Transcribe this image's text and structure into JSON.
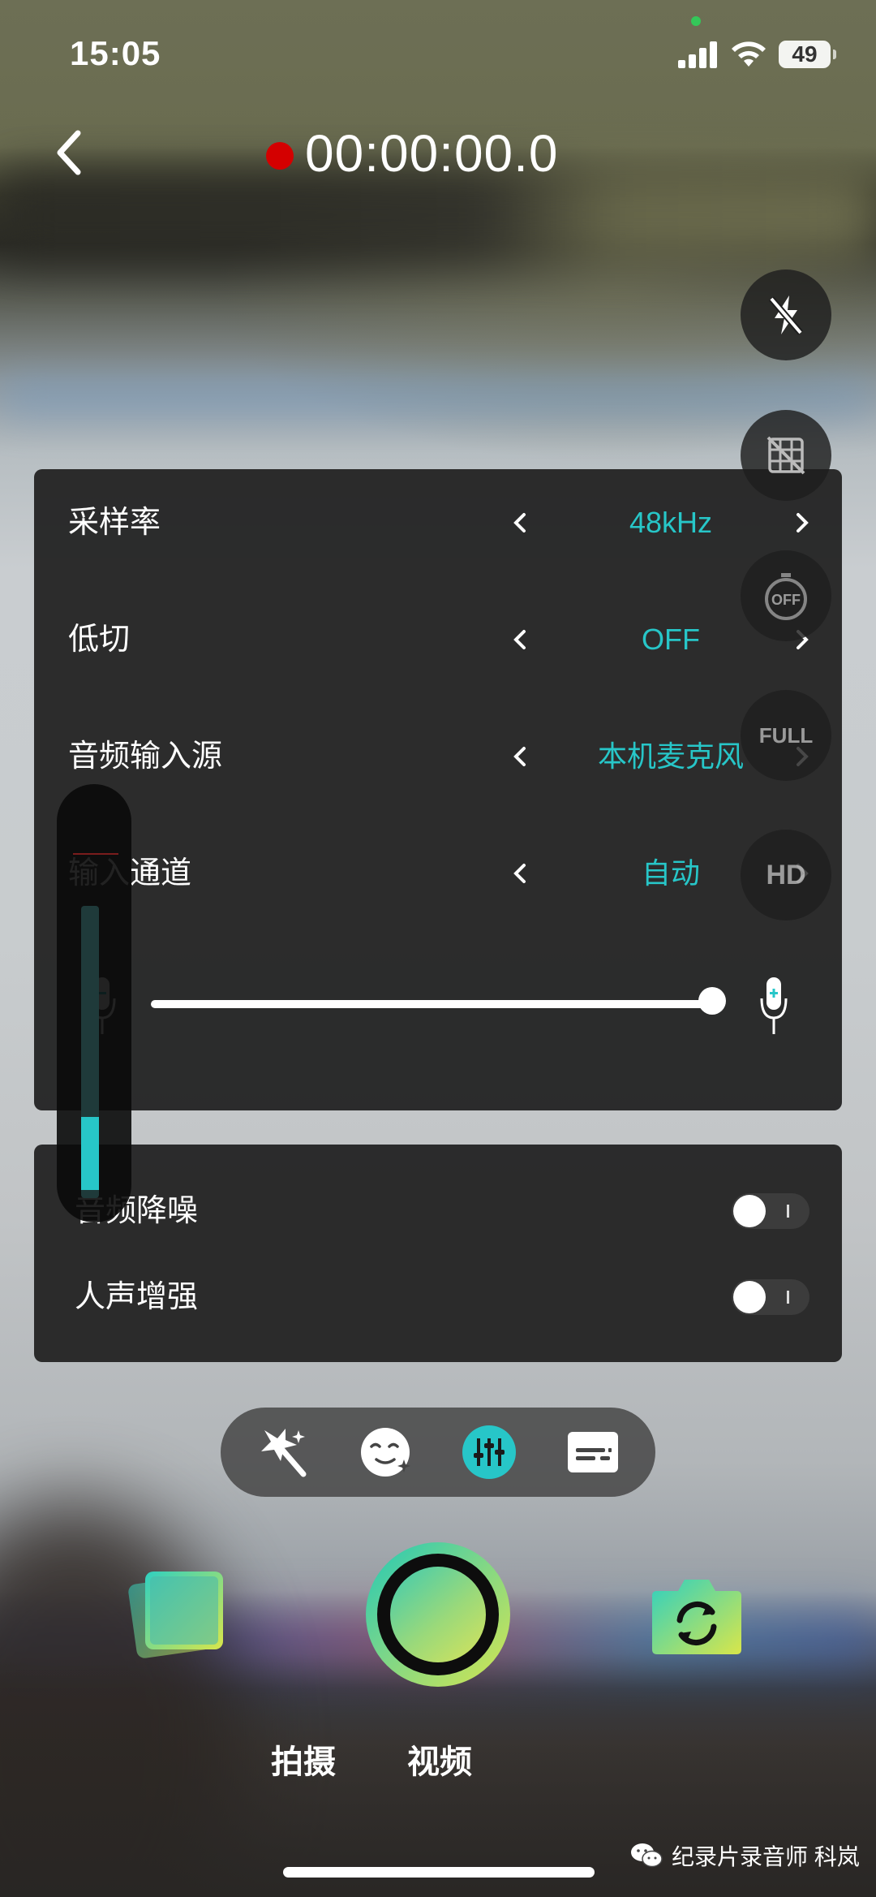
{
  "status_bar": {
    "time": "15:05",
    "battery": "49",
    "signal_bars": 4,
    "recording_indicator_color": "#34c759"
  },
  "top_bar": {
    "recording_time": "00:00:00.0",
    "recording_color": "#d40000"
  },
  "side_buttons": [
    {
      "icon": "flash-off-icon",
      "label": ""
    },
    {
      "icon": "grid-off-icon",
      "label": ""
    },
    {
      "icon": "timer-off-icon",
      "label": "OFF"
    },
    {
      "icon": "aspect-full-icon",
      "label": "FULL"
    },
    {
      "icon": "quality-hd-icon",
      "label": "HD"
    }
  ],
  "audio_settings": {
    "rows": [
      {
        "name": "采样率",
        "value": "48kHz"
      },
      {
        "name": "低切",
        "value": "OFF"
      },
      {
        "name": "音频输入源",
        "value": "本机麦克风"
      },
      {
        "name": "输入通道",
        "value": "自动"
      }
    ],
    "gain_level": 1.0,
    "accent_color": "#27c6c8"
  },
  "toggles": [
    {
      "name": "音频降噪",
      "on": false
    },
    {
      "name": "人声增强",
      "on": false
    }
  ],
  "level_meter": {
    "level": 0.25
  },
  "tool_pill": {
    "items": [
      "magic-wand-icon",
      "beauty-face-icon",
      "audio-mixer-icon",
      "subtitle-icon"
    ],
    "active_index": 2
  },
  "modes": {
    "photo": "拍摄",
    "video": "视频"
  },
  "watermark": {
    "text": "纪录片录音师 科岚"
  }
}
